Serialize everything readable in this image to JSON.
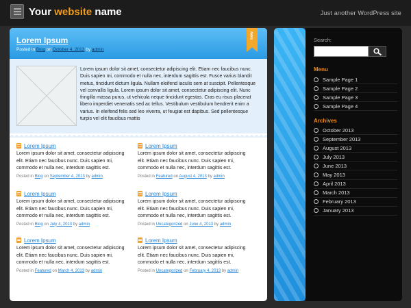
{
  "header": {
    "title_prefix": "Your ",
    "title_accent": "website",
    "title_suffix": " name",
    "tagline": "Just another WordPress site"
  },
  "featured": {
    "title": "Lorem Ipsum",
    "badge": "new",
    "meta_prefix": "Posted in",
    "category": "Blog",
    "meta_on": "on",
    "date": "October 4, 2013",
    "meta_by": "by",
    "author": "admin",
    "text": "Lorem ipsum dolor sit amet, consectetur adipiscing elit. Etiam nec faucibus nunc. Duis sapien mi, commodo et nulla nec, interdum sagittis est. Fusce varius blandit metus, tincidunt dictum ligula. Nullam eleifend iaculis sem at suscipit. Pellentesque vel convallis ligula. Lorem ipsum dolor sit amet, consectetur adipiscing elit. Nunc fringilla massa purus, ut vehicula neque tincidunt egestas. Cras eu risus placerat libero imperdiet venenatis sed ac tellus. Vestibulum vestibulum hendrerit enim a varius. In eleifend felis sed leo viverra, ut feugiat est dapibus. Sed pellentesque turpis vel elit faucibus mattis"
  },
  "posts": [
    {
      "title": "Lorem Ipsum",
      "text": "Lorem ipsum dolor sit amet, consectetur adipiscing elit. Etiam nec faucibus nunc. Duis sapien mi, commodo et nulla nec, interdum sagittis est.",
      "meta_prefix": "Posted in",
      "category": "Blog",
      "meta_on": "on",
      "date": "September 4, 2013",
      "meta_by": "by",
      "author": "admin"
    },
    {
      "title": "Lorem Ipsum",
      "text": "Lorem ipsum dolor sit amet, consectetur adipiscing elit. Etiam nec faucibus nunc. Duis sapien mi, commodo et nulla nec, interdum sagittis est.",
      "meta_prefix": "Posted in",
      "category": "Featured",
      "meta_on": "on",
      "date": "August 4, 2013",
      "meta_by": "by",
      "author": "admin"
    },
    {
      "title": "Lorem Ipsum",
      "text": "Lorem ipsum dolor sit amet, consectetur adipiscing elit. Etiam nec faucibus nunc. Duis sapien mi, commodo et nulla nec, interdum sagittis est.",
      "meta_prefix": "Posted in",
      "category": "Blog",
      "meta_on": "on",
      "date": "July 4, 2013",
      "meta_by": "by",
      "author": "admin"
    },
    {
      "title": "Lorem Ipsum",
      "text": "Lorem ipsum dolor sit amet, consectetur adipiscing elit. Etiam nec faucibus nunc. Duis sapien mi, commodo et nulla nec, interdum sagittis est.",
      "meta_prefix": "Posted in",
      "category": "Uncategorized",
      "meta_on": "on",
      "date": "June 4, 2013",
      "meta_by": "by",
      "author": "admin"
    },
    {
      "title": "Lorem Ipsum",
      "text": "Lorem ipsum dolor sit amet, consectetur adipiscing elit. Etiam nec faucibus nunc. Duis sapien mi, commodo et nulla nec, interdum sagittis est.",
      "meta_prefix": "Posted in",
      "category": "Featured",
      "meta_on": "on",
      "date": "March 4, 2013",
      "meta_by": "by",
      "author": "admin"
    },
    {
      "title": "Lorem Ipsum",
      "text": "Lorem ipsum dolor sit amet, consectetur adipiscing elit. Etiam nec faucibus nunc. Duis sapien mi, commodo et nulla nec, interdum sagittis est.",
      "meta_prefix": "Posted in",
      "category": "Uncategorized",
      "meta_on": "on",
      "date": "February 4, 2013",
      "meta_by": "by",
      "author": "admin"
    }
  ],
  "sidebar": {
    "search_label": "Search:",
    "menu_title": "Menu",
    "menu_items": [
      "Sample Page 1",
      "Sample Page 2",
      "Sample Page 3",
      "Sample Page 4"
    ],
    "archives_title": "Archives",
    "archives": [
      "October 2013",
      "September 2013",
      "August 2013",
      "July 2013",
      "June 2013",
      "May 2013",
      "April 2013",
      "March 2013",
      "February 2013",
      "January 2013"
    ]
  },
  "colors": {
    "accent_orange": "#f39c1c",
    "link_blue": "#1f7fd3",
    "featured_blue": "#2a9ae3"
  }
}
